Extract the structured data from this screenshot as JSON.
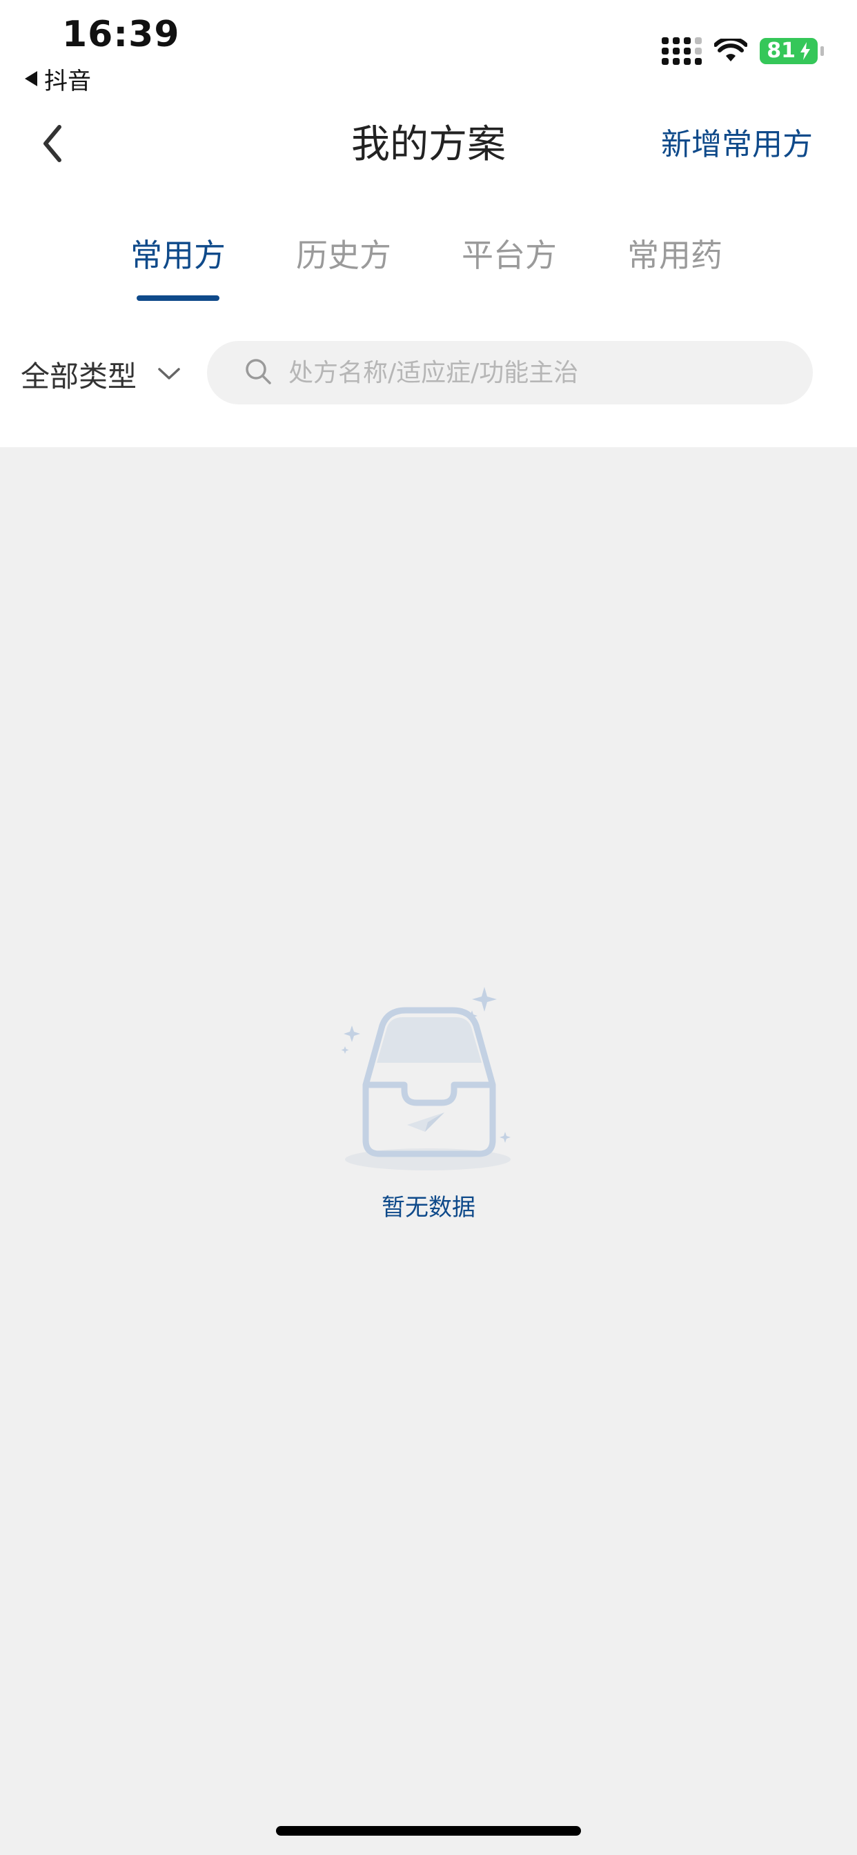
{
  "status_bar": {
    "time": "16:39",
    "back_app": "抖音",
    "battery_level": "81",
    "battery_charging": true,
    "icons": [
      "signal-icon",
      "wifi-icon",
      "battery-icon"
    ]
  },
  "nav": {
    "title": "我的方案",
    "action_label": "新增常用方",
    "back_icon": "chevron-left-icon"
  },
  "tabs": {
    "active_index": 0,
    "items": [
      {
        "label": "常用方"
      },
      {
        "label": "历史方"
      },
      {
        "label": "平台方"
      },
      {
        "label": "常用药"
      }
    ]
  },
  "filter": {
    "label": "全部类型",
    "icon": "chevron-down-icon"
  },
  "search": {
    "placeholder": "处方名称/适应症/功能主治",
    "value": "",
    "icon": "search-icon"
  },
  "empty_state": {
    "text": "暂无数据",
    "icon": "empty-box-icon"
  },
  "colors": {
    "accent": "#0f4a8a",
    "tab_inactive": "#9a9a9a",
    "background": "#f0f0f0",
    "header_bg": "#ffffff",
    "battery": "#35c759",
    "illustration": "#c3d1e3"
  }
}
